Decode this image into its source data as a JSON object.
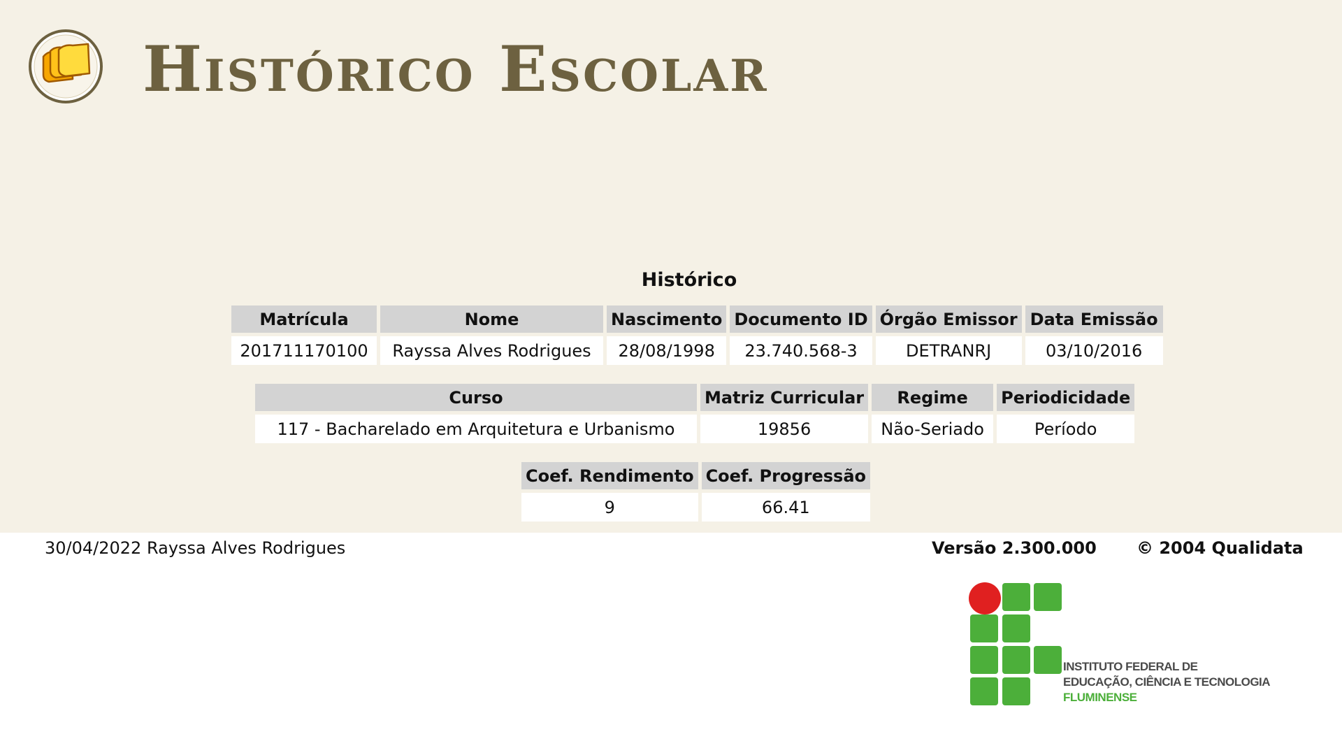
{
  "header": {
    "title": "Histórico Escolar",
    "icon": "documents-icon"
  },
  "section_title": "Histórico",
  "aluno_table": {
    "headers": [
      "Matrícula",
      "Nome",
      "Nascimento",
      "Documento ID",
      "Órgão Emissor",
      "Data Emissão"
    ],
    "row": [
      "201711170100",
      "Rayssa Alves Rodrigues",
      "28/08/1998",
      "23.740.568-3",
      "DETRANRJ",
      "03/10/2016"
    ]
  },
  "curso_table": {
    "headers": [
      "Curso",
      "Matriz Curricular",
      "Regime",
      "Periodicidade"
    ],
    "row": [
      "117 - Bacharelado em Arquitetura e Urbanismo",
      "19856",
      "Não-Seriado",
      "Período"
    ]
  },
  "coef_table": {
    "headers": [
      "Coef. Rendimento",
      "Coef. Progressão"
    ],
    "row": [
      "9",
      "66.41"
    ]
  },
  "footer": {
    "date_user": "30/04/2022 Rayssa Alves Rodrigues",
    "version": "Versão 2.300.000",
    "copyright": "© 2004 Qualidata"
  },
  "logo": {
    "line1": "INSTITUTO FEDERAL DE",
    "line2": "EDUCAÇÃO, CIÊNCIA E TECNOLOGIA",
    "line3": "FLUMINENSE",
    "colors": {
      "green": "#4caf3a",
      "red": "#e02020"
    }
  },
  "colors": {
    "background": "#f5f1e6",
    "title": "#6d6140",
    "table_header": "#d3d3d3"
  }
}
